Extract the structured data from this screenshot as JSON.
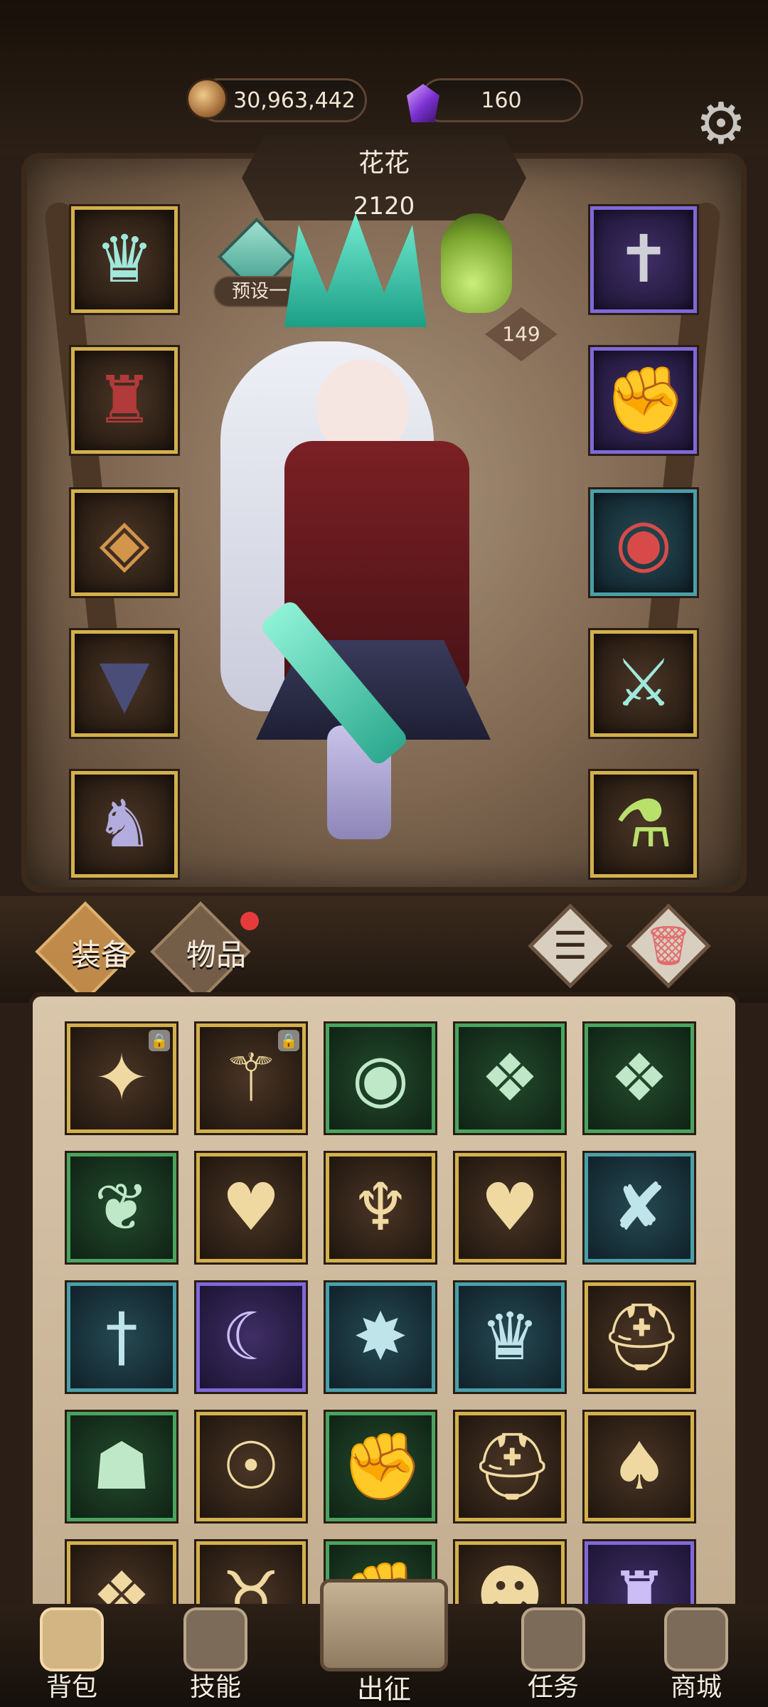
{
  "resources": {
    "gold": "30,963,442",
    "gems": "160"
  },
  "hero": {
    "name": "花花",
    "power": "2120",
    "preset": "预设一",
    "level_badge": "149"
  },
  "equipment_slots": {
    "left": [
      {
        "slot": "weapon-crown",
        "rarity": "gold",
        "icon": "crown-icon"
      },
      {
        "slot": "armor",
        "rarity": "gold",
        "icon": "coat-icon"
      },
      {
        "slot": "bracer",
        "rarity": "gold",
        "icon": "bracer-icon"
      },
      {
        "slot": "skirt",
        "rarity": "gold",
        "icon": "skirt-icon"
      },
      {
        "slot": "boots",
        "rarity": "gold",
        "icon": "boots-icon"
      }
    ],
    "right": [
      {
        "slot": "necklace",
        "rarity": "purple",
        "icon": "cross-necklace-icon"
      },
      {
        "slot": "gauntlet",
        "rarity": "purple",
        "icon": "gauntlet-icon"
      },
      {
        "slot": "ring",
        "rarity": "teal",
        "icon": "ring-icon"
      },
      {
        "slot": "blade",
        "rarity": "gold",
        "icon": "blade-icon"
      },
      {
        "slot": "potion",
        "rarity": "gold",
        "icon": "potion-icon"
      }
    ]
  },
  "tabs": {
    "equipment": "装备",
    "items": "物品"
  },
  "inventory": [
    {
      "rarity": "gold",
      "icon": "spear-icon",
      "locked": true
    },
    {
      "rarity": "gold",
      "icon": "staff-icon",
      "locked": true
    },
    {
      "rarity": "green",
      "icon": "ring-icon",
      "locked": false
    },
    {
      "rarity": "green",
      "icon": "necklace-icon",
      "locked": false
    },
    {
      "rarity": "green",
      "icon": "necklace-icon",
      "locked": false
    },
    {
      "rarity": "green",
      "icon": "winged-relic-icon",
      "locked": false
    },
    {
      "rarity": "gold",
      "icon": "heart-amulet-icon",
      "locked": false
    },
    {
      "rarity": "gold",
      "icon": "chalice-icon",
      "locked": false
    },
    {
      "rarity": "gold",
      "icon": "heart-amulet-icon",
      "locked": false
    },
    {
      "rarity": "teal",
      "icon": "ribbon-icon",
      "locked": false
    },
    {
      "rarity": "teal",
      "icon": "sword-icon",
      "locked": false
    },
    {
      "rarity": "purple",
      "icon": "scythe-icon",
      "locked": false
    },
    {
      "rarity": "teal",
      "icon": "star-ring-icon",
      "locked": false
    },
    {
      "rarity": "teal",
      "icon": "robe-icon",
      "locked": false
    },
    {
      "rarity": "gold",
      "icon": "helmet-icon",
      "locked": false
    },
    {
      "rarity": "green",
      "icon": "hood-icon",
      "locked": false
    },
    {
      "rarity": "gold",
      "icon": "pendant-icon",
      "locked": false
    },
    {
      "rarity": "green",
      "icon": "gauntlet-icon",
      "locked": false
    },
    {
      "rarity": "gold",
      "icon": "helmet-icon",
      "locked": false
    },
    {
      "rarity": "gold",
      "icon": "cape-icon",
      "locked": false
    },
    {
      "rarity": "gold",
      "icon": "necklace-icon",
      "locked": false
    },
    {
      "rarity": "gold",
      "icon": "horned-helm-icon",
      "locked": false
    },
    {
      "rarity": "green",
      "icon": "gauntlet-icon",
      "locked": false
    },
    {
      "rarity": "gold",
      "icon": "mask-icon",
      "locked": false
    },
    {
      "rarity": "purple",
      "icon": "armor-icon",
      "locked": false
    }
  ],
  "nav": {
    "bag": "背包",
    "skills": "技能",
    "expedition": "出征",
    "quests": "任务",
    "shop": "商城"
  }
}
